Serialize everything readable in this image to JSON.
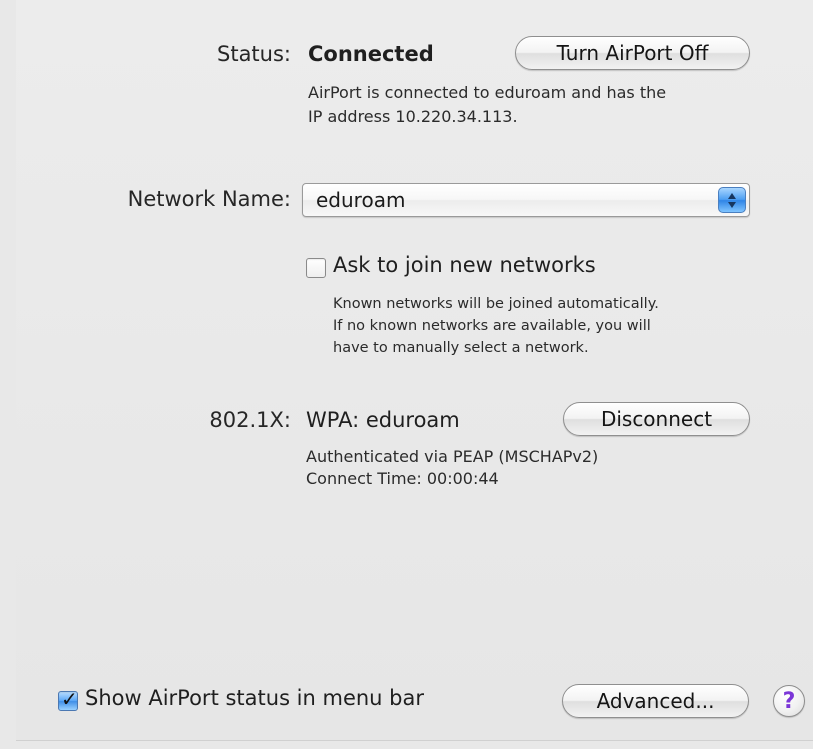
{
  "status": {
    "label": "Status:",
    "value": "Connected",
    "button_label": "Turn AirPort Off",
    "description_line1": "AirPort is connected to eduroam and has the",
    "description_line2": "IP address 10.220.34.113."
  },
  "network": {
    "label": "Network Name:",
    "selected": "eduroam",
    "ask_to_join_label": "Ask to join new networks",
    "ask_to_join_checked": false,
    "help_line1": "Known networks will be joined automatically.",
    "help_line2": "If no known networks are available, you will",
    "help_line3": "have to manually select a network."
  },
  "auth": {
    "label": "802.1X:",
    "value": "WPA: eduroam",
    "button_label": "Disconnect",
    "line1": "Authenticated via PEAP (MSCHAPv2)",
    "line2": "Connect Time: 00:00:44"
  },
  "footer": {
    "show_status_label": "Show AirPort status in menu bar",
    "show_status_checked": true,
    "advanced_label": "Advanced...",
    "help_symbol": "?"
  },
  "icons": {
    "stepper": "up-down-stepper-icon",
    "checkmark": "checkmark-icon",
    "help": "question-mark-icon"
  },
  "colors": {
    "background": "#ececec",
    "accent_blue": "#4d9ff2",
    "help_purple": "#7b36d7"
  }
}
